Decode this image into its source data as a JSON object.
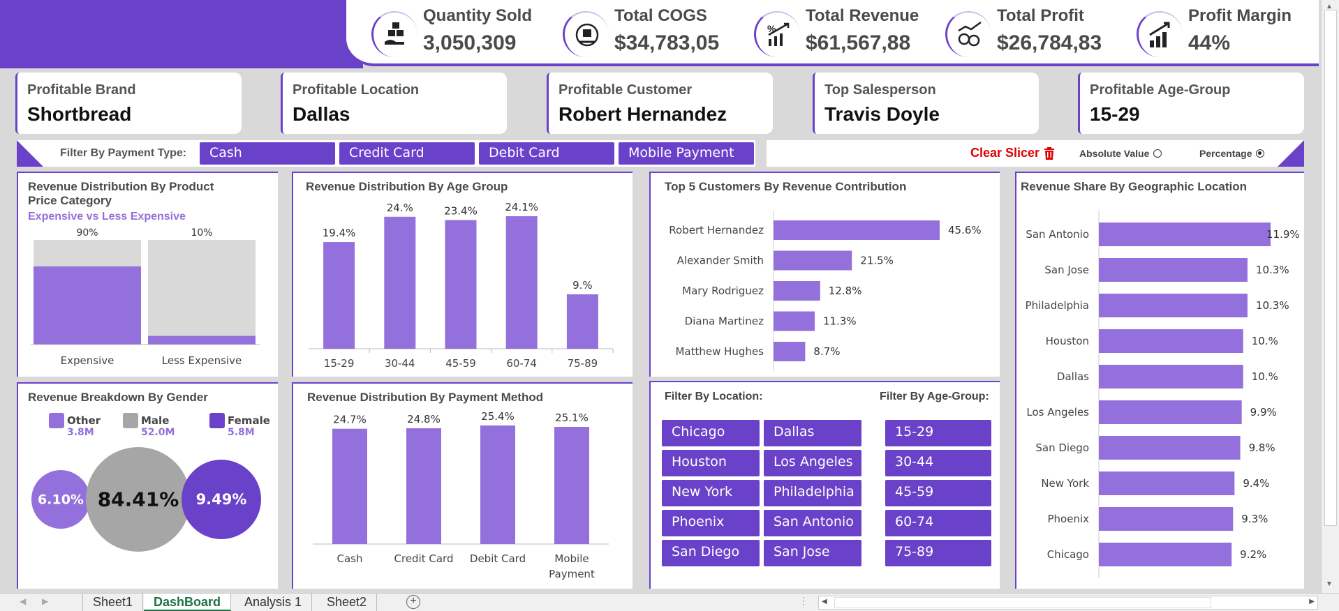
{
  "kpis": [
    {
      "label": "Quantity Sold",
      "value": "3,050,309",
      "icon": "stacked-boxes-hand-icon"
    },
    {
      "label": "Total COGS",
      "value": "$34,783,05",
      "icon": "package-coins-icon"
    },
    {
      "label": "Total Revenue",
      "value": "$61,567,88",
      "icon": "percent-growth-chart-icon"
    },
    {
      "label": "Total Profit",
      "value": "$26,784,83",
      "icon": "coin-stacks-growth-icon"
    },
    {
      "label": "Profit Margin",
      "value": "44%",
      "icon": "bar-chart-arrow-icon"
    }
  ],
  "highlights": [
    {
      "label": "Profitable Brand",
      "value": "Shortbread"
    },
    {
      "label": "Profitable Location",
      "value": "Dallas"
    },
    {
      "label": "Profitable Customer",
      "value": "Robert Hernandez"
    },
    {
      "label": "Top Salesperson",
      "value": "Travis Doyle"
    },
    {
      "label": "Profitable Age-Group",
      "value": "15-29"
    }
  ],
  "payment_filter": {
    "label": "Filter By Payment Type:",
    "options": [
      "Cash",
      "Credit Card",
      "Debit Card",
      "Mobile Payment"
    ]
  },
  "clear_slicer": "Clear Slicer",
  "display_mode": {
    "absolute_label": "Absolute Value",
    "percentage_label": "Percentage",
    "selected": "Percentage"
  },
  "panels": {
    "price_category": {
      "title": "Revenue Distribution By Product Price Category",
      "subtitle": "Expensive vs Less Expensive"
    },
    "age_group": {
      "title": "Revenue Distribution By Age Group"
    },
    "top_customers": {
      "title": "Top 5 Customers By Revenue Contribution"
    },
    "geo": {
      "title": "Revenue Share By Geographic Location"
    },
    "gender": {
      "title": "Revenue Breakdown By Gender"
    },
    "payment_method": {
      "title": "Revenue Distribution By Payment Method"
    },
    "slicers": {
      "location_title": "Filter By Location:",
      "age_title": "Filter By Age-Group:",
      "locations": [
        "Chicago",
        "Dallas",
        "Houston",
        "Los Angeles",
        "New York",
        "Philadelphia",
        "Phoenix",
        "San Antonio",
        "San Diego",
        "San Jose"
      ],
      "age_groups": [
        "15-29",
        "30-44",
        "45-59",
        "60-74",
        "75-89"
      ]
    }
  },
  "chart_data": [
    {
      "type": "bar",
      "id": "price_category",
      "categories": [
        "Expensive",
        "Less Expensive"
      ],
      "values": [
        90,
        10
      ],
      "labels": [
        "90%",
        "10%"
      ],
      "unit": "%",
      "ylim": [
        0,
        100
      ],
      "background_bars": true,
      "colors": {
        "bar": "#9370db",
        "background": "#d9d9d9"
      }
    },
    {
      "type": "bar",
      "id": "age_group",
      "categories": [
        "15-29",
        "30-44",
        "45-59",
        "60-74",
        "75-89"
      ],
      "values": [
        19.4,
        24.0,
        23.4,
        24.1,
        9.9
      ],
      "labels": [
        "19.4%",
        "24.%",
        "23.4%",
        "24.1%",
        "9.%"
      ],
      "unit": "%"
    },
    {
      "type": "bar",
      "id": "top_customers",
      "orientation": "horizontal",
      "categories": [
        "Robert Hernandez",
        "Alexander Smith",
        "Mary Rodriguez",
        "Diana Martinez",
        "Matthew Hughes"
      ],
      "values": [
        45.6,
        21.5,
        12.8,
        11.3,
        8.7
      ],
      "labels": [
        "45.6%",
        "21.5%",
        "12.8%",
        "11.3%",
        "8.7%"
      ],
      "unit": "%"
    },
    {
      "type": "bar",
      "id": "geo",
      "orientation": "horizontal",
      "categories": [
        "San Antonio",
        "San Jose",
        "Philadelphia",
        "Houston",
        "Dallas",
        "Los Angeles",
        "San Diego",
        "New York",
        "Phoenix",
        "Chicago"
      ],
      "values": [
        11.9,
        10.3,
        10.3,
        10.0,
        10.0,
        9.9,
        9.8,
        9.4,
        9.3,
        9.2
      ],
      "labels": [
        "11.9%",
        "10.3%",
        "10.3%",
        "10.%",
        "10.%",
        "9.9%",
        "9.8%",
        "9.4%",
        "9.3%",
        "9.2%"
      ],
      "unit": "%"
    },
    {
      "type": "bubble",
      "id": "gender",
      "categories": [
        "Other",
        "Male",
        "Female"
      ],
      "values": [
        6.1,
        84.41,
        9.49
      ],
      "labels": [
        "6.10%",
        "84.41%",
        "9.49%"
      ],
      "legend_values": [
        "3.8M",
        "52.0M",
        "5.8M"
      ],
      "colors": {
        "Other": "#9370db",
        "Male": "#a6a6a6",
        "Female": "#6a41c9"
      }
    },
    {
      "type": "bar",
      "id": "payment_method",
      "categories": [
        "Cash",
        "Credit Card",
        "Debit Card",
        "Mobile Payment"
      ],
      "values": [
        24.7,
        24.8,
        25.4,
        25.1
      ],
      "labels": [
        "24.7%",
        "24.8%",
        "25.4%",
        "25.1%"
      ],
      "unit": "%"
    }
  ],
  "sheet_tabs": [
    "Sheet1",
    "DashBoard",
    "Analysis 1",
    "Sheet2"
  ],
  "active_sheet": "DashBoard",
  "colors": {
    "accent": "#6a41c9",
    "bar": "#9370db",
    "alert": "#e00000",
    "sheet_active": "#1e7145"
  }
}
